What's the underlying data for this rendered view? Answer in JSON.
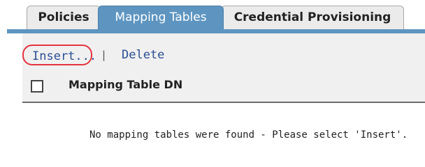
{
  "tabs": [
    {
      "label": "Policies",
      "active": false
    },
    {
      "label": "Mapping Tables",
      "active": true
    },
    {
      "label": "Credential Provisioning",
      "active": false
    }
  ],
  "actions": {
    "insert_label": "Insert...",
    "separator": "|",
    "delete_label": "Delete"
  },
  "table": {
    "columns": [
      "Mapping Table DN"
    ],
    "empty_message": "No mapping tables were found - Please select 'Insert'."
  },
  "colors": {
    "active_tab": "#5e95c0",
    "inactive_tab": "#ebebeb",
    "link": "#2a4f93",
    "highlight_circle": "#e53340"
  }
}
